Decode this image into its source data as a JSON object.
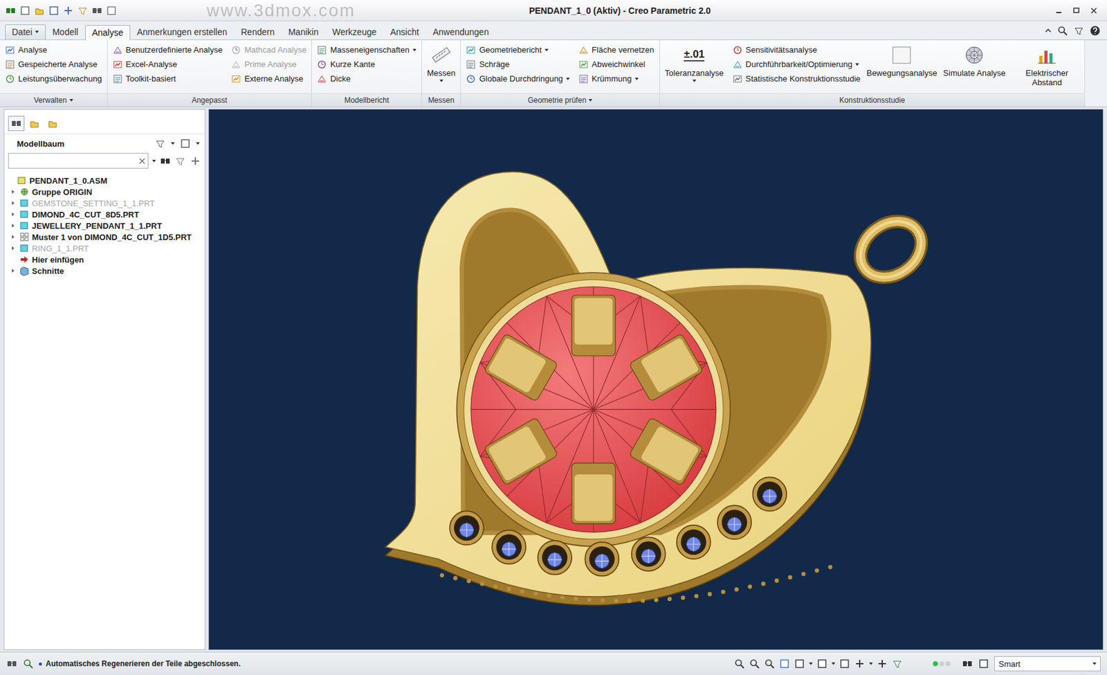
{
  "window": {
    "title": "PENDANT_1_0 (Aktiv) - Creo Parametric 2.0",
    "watermark": "www.3dmox.com"
  },
  "tabs": [
    {
      "label": "Datei",
      "selected": false,
      "dropdown": true
    },
    {
      "label": "Modell",
      "selected": false,
      "dropdown": false
    },
    {
      "label": "Analyse",
      "selected": true,
      "dropdown": false
    },
    {
      "label": "Anmerkungen erstellen",
      "selected": false,
      "dropdown": false
    },
    {
      "label": "Rendern",
      "selected": false,
      "dropdown": false
    },
    {
      "label": "Manikin",
      "selected": false,
      "dropdown": false
    },
    {
      "label": "Werkzeuge",
      "selected": false,
      "dropdown": false
    },
    {
      "label": "Ansicht",
      "selected": false,
      "dropdown": false
    },
    {
      "label": "Anwendungen",
      "selected": false,
      "dropdown": false
    }
  ],
  "ribbon": {
    "groups": [
      {
        "label": "Verwalten",
        "dropdown": true,
        "columns": [
          [
            {
              "label": "Analyse",
              "kind": "small",
              "dropdown": false,
              "disabled": false
            },
            {
              "label": "Gespeicherte Analyse",
              "kind": "small",
              "dropdown": false,
              "disabled": false
            },
            {
              "label": "Leistungsüberwachung",
              "kind": "small",
              "dropdown": false,
              "disabled": false
            }
          ]
        ]
      },
      {
        "label": "Angepasst",
        "dropdown": false,
        "columns": [
          [
            {
              "label": "Benutzerdefinierte Analyse",
              "kind": "small",
              "dropdown": false,
              "disabled": false
            },
            {
              "label": "Excel-Analyse",
              "kind": "small",
              "dropdown": false,
              "disabled": false
            },
            {
              "label": "Toolkit-basiert",
              "kind": "small",
              "dropdown": false,
              "disabled": false
            }
          ],
          [
            {
              "label": "Mathcad Analyse",
              "kind": "small",
              "dropdown": false,
              "disabled": true
            },
            {
              "label": "Prime Analyse",
              "kind": "small",
              "dropdown": false,
              "disabled": true
            },
            {
              "label": "Externe Analyse",
              "kind": "small",
              "dropdown": false,
              "disabled": false
            }
          ]
        ]
      },
      {
        "label": "Modellbericht",
        "dropdown": false,
        "columns": [
          [
            {
              "label": "Masseneigenschaften",
              "kind": "small",
              "dropdown": true,
              "disabled": false
            },
            {
              "label": "Kurze Kante",
              "kind": "small",
              "dropdown": false,
              "disabled": false
            },
            {
              "label": "Dicke",
              "kind": "small",
              "dropdown": false,
              "disabled": false
            }
          ]
        ]
      },
      {
        "label": "Messen",
        "dropdown": false,
        "columns": [
          [
            {
              "label": "Messen",
              "kind": "large",
              "dropdown": true,
              "disabled": false,
              "icon_text": ""
            }
          ]
        ]
      },
      {
        "label": "Geometrie prüfen",
        "dropdown": true,
        "columns": [
          [
            {
              "label": "Geometriebericht",
              "kind": "small",
              "dropdown": true,
              "disabled": false
            },
            {
              "label": "Schräge",
              "kind": "small",
              "dropdown": false,
              "disabled": false
            },
            {
              "label": "Globale Durchdringung",
              "kind": "small",
              "dropdown": true,
              "disabled": false
            }
          ],
          [
            {
              "label": "Fläche vernetzen",
              "kind": "small",
              "dropdown": false,
              "disabled": false
            },
            {
              "label": "Abweichwinkel",
              "kind": "small",
              "dropdown": false,
              "disabled": false
            },
            {
              "label": "Krümmung",
              "kind": "small",
              "dropdown": true,
              "disabled": false
            }
          ]
        ]
      },
      {
        "label": "Konstruktionsstudie",
        "dropdown": false,
        "columns": [
          [
            {
              "label": "Toleranzanalyse",
              "kind": "large",
              "dropdown": true,
              "disabled": false,
              "icon_text": "±.01"
            }
          ],
          [
            {
              "label": "Sensitivitätsanalyse",
              "kind": "small",
              "dropdown": false,
              "disabled": false
            },
            {
              "label": "Durchführbarkeit/Optimierung",
              "kind": "small",
              "dropdown": true,
              "disabled": false
            },
            {
              "label": "Statistische Konstruktionsstudie",
              "kind": "small",
              "dropdown": false,
              "disabled": false
            }
          ],
          [
            {
              "label": "Bewegungsanalyse",
              "kind": "large",
              "dropdown": false,
              "disabled": false,
              "icon_text": ""
            }
          ],
          [
            {
              "label": "Simulate Analyse",
              "kind": "large",
              "dropdown": false,
              "disabled": false,
              "icon_text": ""
            }
          ],
          [
            {
              "label": "Elektrischer Abstand",
              "kind": "large",
              "dropdown": false,
              "disabled": false,
              "icon_text": ""
            }
          ]
        ]
      }
    ]
  },
  "model_tree": {
    "title": "Modellbaum",
    "search": {
      "value": ""
    },
    "items": [
      {
        "label": "PENDANT_1_0.ASM",
        "kind": "assembly",
        "level": 0,
        "expandable": false,
        "disabled": false
      },
      {
        "label": "Gruppe ORIGIN",
        "kind": "group",
        "level": 1,
        "expandable": true,
        "disabled": false
      },
      {
        "label": "GEMSTONE_SETTING_1_1.PRT",
        "kind": "part",
        "level": 1,
        "expandable": true,
        "disabled": true
      },
      {
        "label": "DIMOND_4C_CUT_8D5.PRT",
        "kind": "part",
        "level": 1,
        "expandable": true,
        "disabled": false
      },
      {
        "label": "JEWELLERY_PENDANT_1_1.PRT",
        "kind": "part",
        "level": 1,
        "expandable": true,
        "disabled": false
      },
      {
        "label": "Muster 1 von DIMOND_4C_CUT_1D5.PRT",
        "kind": "pattern",
        "level": 1,
        "expandable": true,
        "disabled": false
      },
      {
        "label": "RING_1_1.PRT",
        "kind": "part",
        "level": 1,
        "expandable": true,
        "disabled": true
      },
      {
        "label": "Hier einfügen",
        "kind": "insert",
        "level": 1,
        "expandable": false,
        "disabled": false
      },
      {
        "label": "Schnitte",
        "kind": "sections",
        "level": 1,
        "expandable": true,
        "disabled": false
      }
    ]
  },
  "status_bar": {
    "message": "Automatisches Regenerieren der Teile abgeschlossen.",
    "filter": "Smart"
  }
}
